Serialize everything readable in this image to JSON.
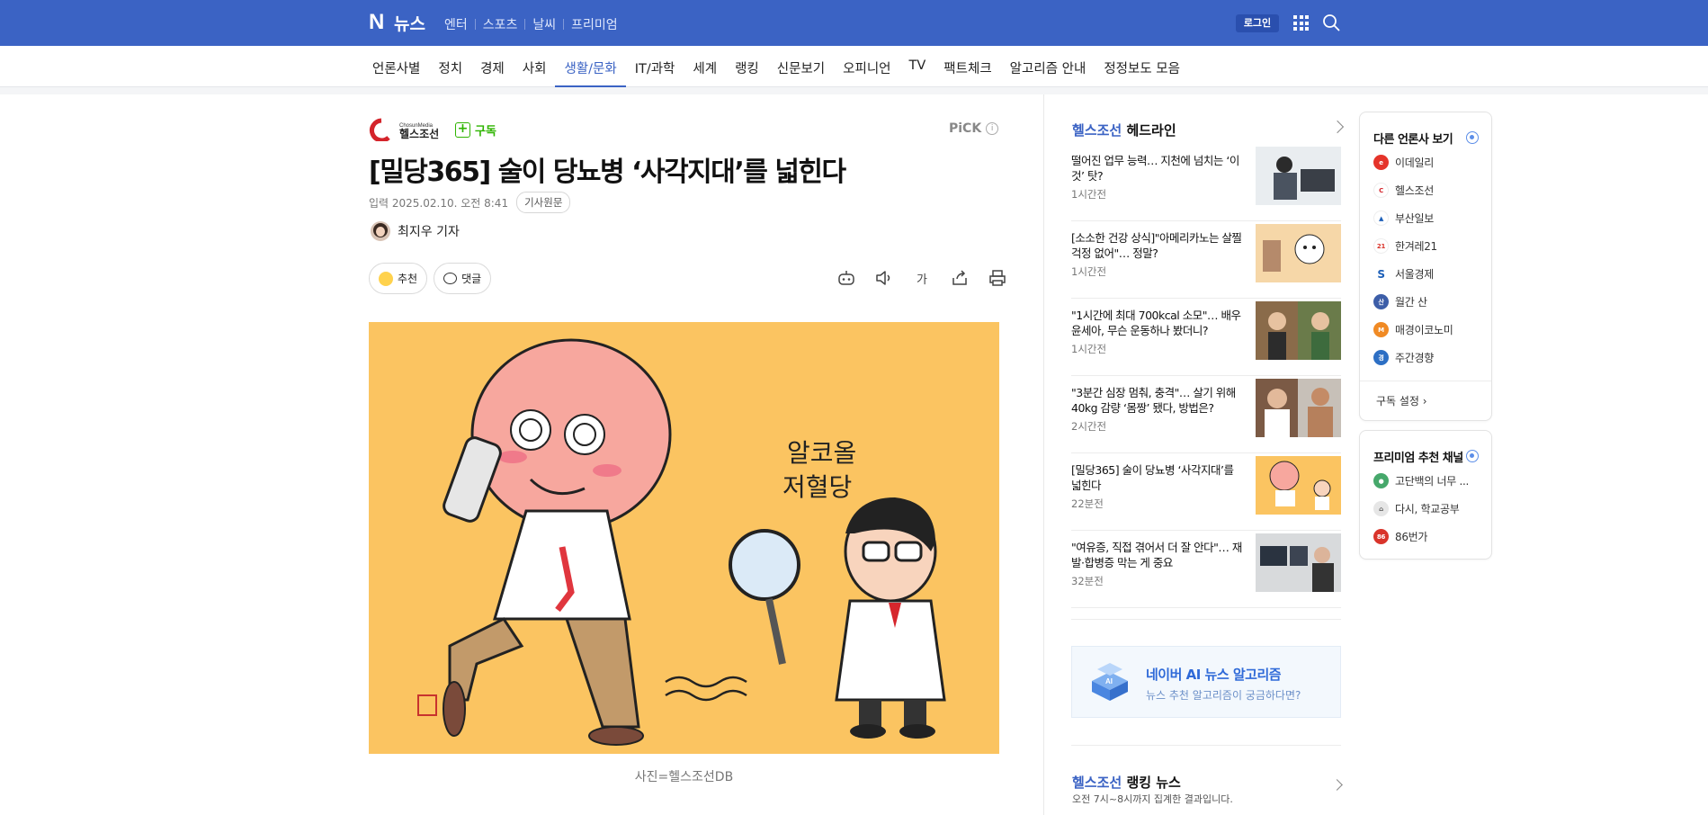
{
  "topbar": {
    "logo_n": "N",
    "logo_text": "뉴스",
    "nav": [
      "엔터",
      "스포츠",
      "날씨",
      "프리미엄"
    ],
    "login": "로그인"
  },
  "category_nav": [
    "언론사별",
    "정치",
    "경제",
    "사회",
    "생활/문화",
    "IT/과학",
    "세계",
    "랭킹",
    "신문보기",
    "오피니언",
    "TV",
    "팩트체크",
    "알고리즘 안내",
    "정정보도 모음"
  ],
  "category_active": "생활/문화",
  "article": {
    "press_small": "ChosunMedia",
    "press_name": "헬스조선",
    "subscribe": "구독",
    "pick": "PiCK",
    "title": "[밀당365] 술이 당뇨병 ‘사각지대’를 넓힌다",
    "date": "입력 2025.02.10. 오전 8:41",
    "original": "기사원문",
    "reporter": "최지우 기자",
    "recommend": "추천",
    "comment": "댓글",
    "font_size_label": "가",
    "image_text_1": "알코올",
    "image_text_2": "저혈당",
    "caption": "사진=헬스조선DB"
  },
  "headline": {
    "brand": "헬스조선",
    "label": "헤드라인",
    "items": [
      {
        "title": "떨어진 업무 능력… 지천에 넘치는 ‘이것’ 탓?",
        "time": "1시간전"
      },
      {
        "title": "[소소한 건강 상식]\"아메리카노는 살찔 걱정 없어\"… 정말?",
        "time": "1시간전"
      },
      {
        "title": "\"1시간에 최대 700kcal 소모\"… 배우 윤세아, 무슨 운동하나 봤더니?",
        "time": "1시간전"
      },
      {
        "title": "\"3분간 심장 멈춰, 충격\"… 살기 위해 40kg 감량 ‘몸짱’ 됐다, 방법은?",
        "time": "2시간전"
      },
      {
        "title": "[밀당365] 술이 당뇨병 ‘사각지대’를 넓힌다",
        "time": "22분전"
      },
      {
        "title": "\"여유증, 직접 겪어서 더 잘 안다\"… 재발·합병증 막는 게 중요",
        "time": "32분전"
      }
    ]
  },
  "ai_banner": {
    "title": "네이버 AI 뉴스 알고리즘",
    "subtitle": "뉴스 추천 알고리즘이 궁금하다면?"
  },
  "ranking": {
    "brand": "헬스조선",
    "label": "랭킹 뉴스",
    "sub": "오전 7시~8시까지 집계한 결과입니다."
  },
  "other_press": {
    "title": "다른 언론사 보기",
    "items": [
      {
        "name": "이데일리",
        "color": "#e5332a"
      },
      {
        "name": "헬스조선",
        "color": "#ffffff"
      },
      {
        "name": "부산일보",
        "color": "#ffffff"
      },
      {
        "name": "한겨레21",
        "color": "#ffffff"
      },
      {
        "name": "서울경제",
        "color": "#ffffff"
      },
      {
        "name": "월간 산",
        "color": "#3d5ea8"
      },
      {
        "name": "매경이코노미",
        "color": "#f08a24"
      },
      {
        "name": "주간경향",
        "color": "#2d6fc4"
      }
    ],
    "setting": "구독 설정"
  },
  "premium": {
    "title": "프리미엄 추천 채널",
    "items": [
      {
        "name": "고단백의 너무 ...",
        "color": "#46a86b"
      },
      {
        "name": "다시, 학교공부",
        "color": "#e6e6e6"
      },
      {
        "name": "86번가",
        "color": "#d9342b"
      }
    ]
  },
  "colors": {
    "brand_blue": "#3b63c4",
    "subscribe_green": "#2eb400",
    "image_bg": "#fbc461"
  }
}
